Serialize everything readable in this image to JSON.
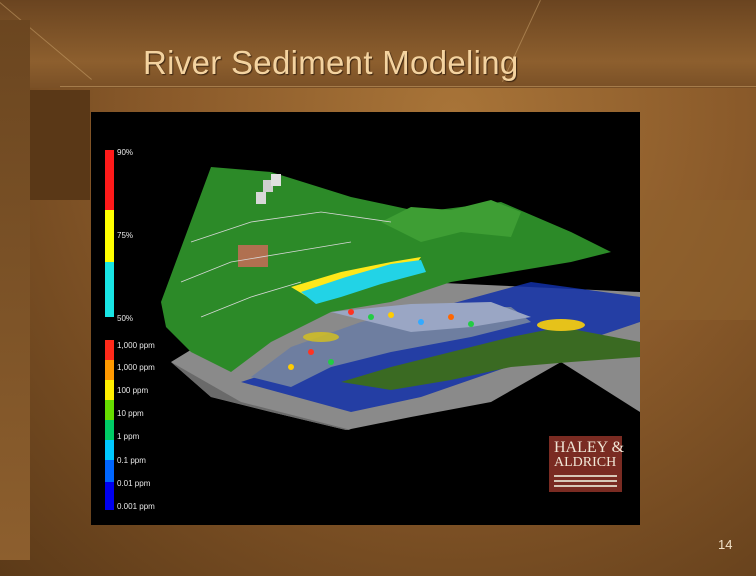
{
  "slide": {
    "title": "River Sediment Modeling",
    "page_number": "14"
  },
  "percent_scale": {
    "labels": [
      "90%",
      "75%",
      "50%"
    ],
    "colors": [
      "#ff1a1a",
      "#ffff00",
      "#19e5e5"
    ]
  },
  "concentration_scale": {
    "labels": [
      "1,000 ppm",
      "1,000 ppm",
      "100 ppm",
      "10 ppm",
      "1 ppm",
      "0.1 ppm",
      "0.01 ppm",
      "0.001 ppm"
    ],
    "colors": [
      "#ff2a1a",
      "#ff9900",
      "#ffee00",
      "#66dd00",
      "#00cc66",
      "#00c8ff",
      "#0066ff",
      "#0000ee"
    ]
  },
  "logo": {
    "line1": "HALEY &",
    "line2": "ALDRICH"
  }
}
